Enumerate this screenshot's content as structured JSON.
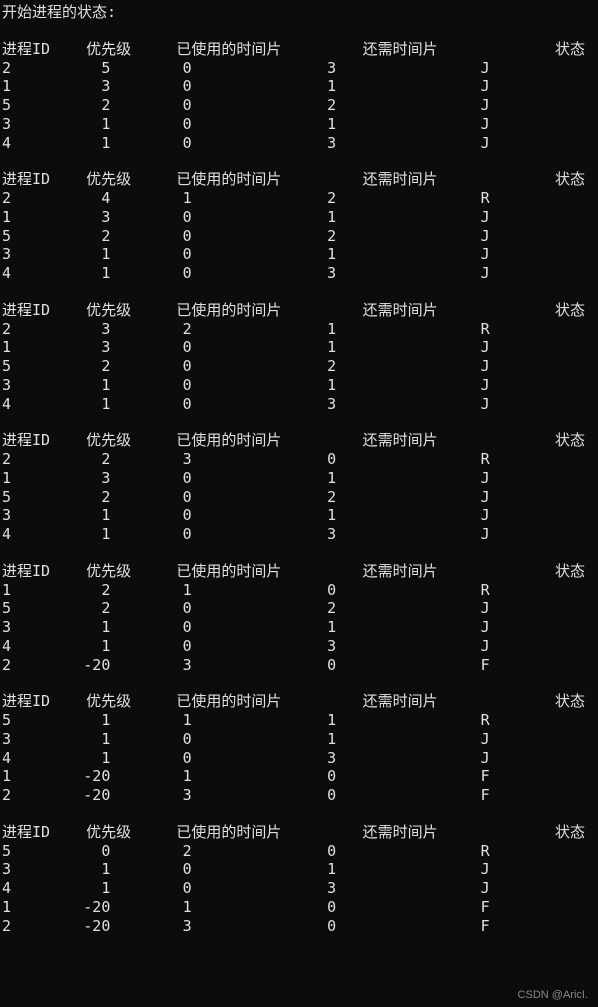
{
  "title": "开始进程的状态:",
  "headers": {
    "id": "进程ID",
    "priority": "优先级",
    "used": "已使用的时间片",
    "need": "还需时间片",
    "state": "状态"
  },
  "watermark": "CSDN @AricI.",
  "blocks": [
    {
      "rows": [
        {
          "id": "2",
          "priority": "5",
          "used": "0",
          "need": "3",
          "state": "J"
        },
        {
          "id": "1",
          "priority": "3",
          "used": "0",
          "need": "1",
          "state": "J"
        },
        {
          "id": "5",
          "priority": "2",
          "used": "0",
          "need": "2",
          "state": "J"
        },
        {
          "id": "3",
          "priority": "1",
          "used": "0",
          "need": "1",
          "state": "J"
        },
        {
          "id": "4",
          "priority": "1",
          "used": "0",
          "need": "3",
          "state": "J"
        }
      ]
    },
    {
      "rows": [
        {
          "id": "2",
          "priority": "4",
          "used": "1",
          "need": "2",
          "state": "R"
        },
        {
          "id": "1",
          "priority": "3",
          "used": "0",
          "need": "1",
          "state": "J"
        },
        {
          "id": "5",
          "priority": "2",
          "used": "0",
          "need": "2",
          "state": "J"
        },
        {
          "id": "3",
          "priority": "1",
          "used": "0",
          "need": "1",
          "state": "J"
        },
        {
          "id": "4",
          "priority": "1",
          "used": "0",
          "need": "3",
          "state": "J"
        }
      ]
    },
    {
      "rows": [
        {
          "id": "2",
          "priority": "3",
          "used": "2",
          "need": "1",
          "state": "R"
        },
        {
          "id": "1",
          "priority": "3",
          "used": "0",
          "need": "1",
          "state": "J"
        },
        {
          "id": "5",
          "priority": "2",
          "used": "0",
          "need": "2",
          "state": "J"
        },
        {
          "id": "3",
          "priority": "1",
          "used": "0",
          "need": "1",
          "state": "J"
        },
        {
          "id": "4",
          "priority": "1",
          "used": "0",
          "need": "3",
          "state": "J"
        }
      ]
    },
    {
      "rows": [
        {
          "id": "2",
          "priority": "2",
          "used": "3",
          "need": "0",
          "state": "R"
        },
        {
          "id": "1",
          "priority": "3",
          "used": "0",
          "need": "1",
          "state": "J"
        },
        {
          "id": "5",
          "priority": "2",
          "used": "0",
          "need": "2",
          "state": "J"
        },
        {
          "id": "3",
          "priority": "1",
          "used": "0",
          "need": "1",
          "state": "J"
        },
        {
          "id": "4",
          "priority": "1",
          "used": "0",
          "need": "3",
          "state": "J"
        }
      ]
    },
    {
      "rows": [
        {
          "id": "1",
          "priority": "2",
          "used": "1",
          "need": "0",
          "state": "R"
        },
        {
          "id": "5",
          "priority": "2",
          "used": "0",
          "need": "2",
          "state": "J"
        },
        {
          "id": "3",
          "priority": "1",
          "used": "0",
          "need": "1",
          "state": "J"
        },
        {
          "id": "4",
          "priority": "1",
          "used": "0",
          "need": "3",
          "state": "J"
        },
        {
          "id": "2",
          "priority": "-20",
          "used": "3",
          "need": "0",
          "state": "F"
        }
      ]
    },
    {
      "rows": [
        {
          "id": "5",
          "priority": "1",
          "used": "1",
          "need": "1",
          "state": "R"
        },
        {
          "id": "3",
          "priority": "1",
          "used": "0",
          "need": "1",
          "state": "J"
        },
        {
          "id": "4",
          "priority": "1",
          "used": "0",
          "need": "3",
          "state": "J"
        },
        {
          "id": "1",
          "priority": "-20",
          "used": "1",
          "need": "0",
          "state": "F"
        },
        {
          "id": "2",
          "priority": "-20",
          "used": "3",
          "need": "0",
          "state": "F"
        }
      ]
    },
    {
      "rows": [
        {
          "id": "5",
          "priority": "0",
          "used": "2",
          "need": "0",
          "state": "R"
        },
        {
          "id": "3",
          "priority": "1",
          "used": "0",
          "need": "1",
          "state": "J"
        },
        {
          "id": "4",
          "priority": "1",
          "used": "0",
          "need": "3",
          "state": "J"
        },
        {
          "id": "1",
          "priority": "-20",
          "used": "1",
          "need": "0",
          "state": "F"
        },
        {
          "id": "2",
          "priority": "-20",
          "used": "3",
          "need": "0",
          "state": "F"
        }
      ]
    }
  ]
}
